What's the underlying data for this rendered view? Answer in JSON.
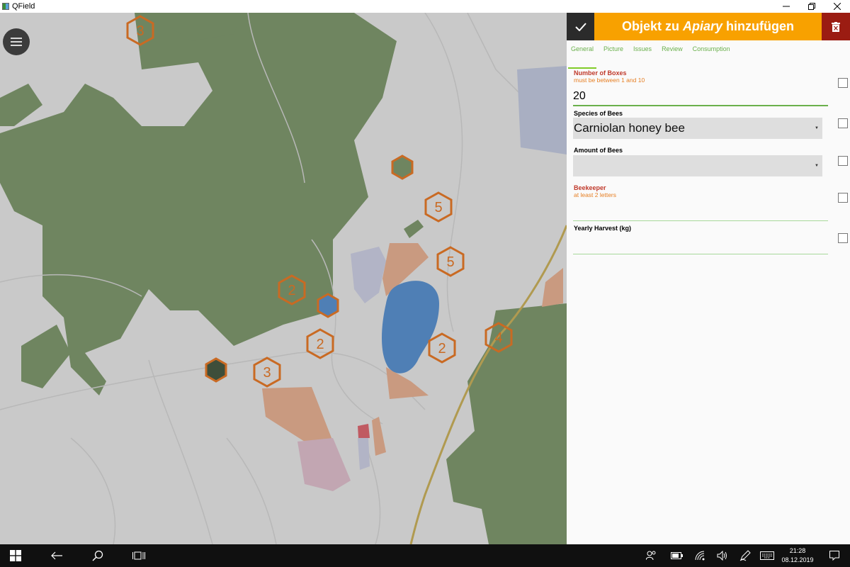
{
  "window": {
    "title": "QField"
  },
  "map": {
    "clusters": [
      {
        "label": "3"
      },
      {
        "label": "5"
      },
      {
        "label": "5"
      },
      {
        "label": "2"
      },
      {
        "label": "2"
      },
      {
        "label": "2"
      },
      {
        "label": "4"
      },
      {
        "label": "3"
      }
    ]
  },
  "form": {
    "title_prefix": "Objekt zu",
    "title_layer": "Apiary",
    "title_suffix": "hinzufügen",
    "tabs": [
      "General",
      "Picture",
      "Issues",
      "Review",
      "Consumption"
    ],
    "active_tab": "General",
    "fields": {
      "boxes": {
        "label": "Number of Boxes",
        "hint": "must be between 1 and 10",
        "value": "20"
      },
      "species": {
        "label": "Species of Bees",
        "value": "Carniolan honey bee"
      },
      "amount": {
        "label": "Amount of Bees",
        "value": ""
      },
      "beekeeper": {
        "label": "Beekeeper",
        "hint": "at least 2 letters",
        "value": ""
      },
      "harvest": {
        "label": "Yearly Harvest (kg)",
        "value": ""
      }
    }
  },
  "taskbar": {
    "time": "21:28",
    "date": "08.12.2019"
  },
  "colors": {
    "accent_orange": "#f8a100",
    "delete_red": "#9b1c12",
    "tab_green": "#6ab04c",
    "error_red": "#c0392b",
    "hint_orange": "#e67e22"
  }
}
